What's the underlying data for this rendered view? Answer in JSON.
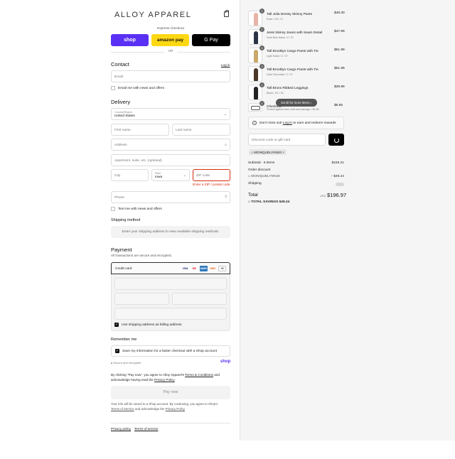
{
  "header": {
    "brand": "ALLOY APPAREL",
    "cart_icon": "shopping-bag-icon"
  },
  "express": {
    "title": "Express checkout",
    "buttons": [
      {
        "label": "shop",
        "color": "#5a31f4"
      },
      {
        "label": "amazon pay",
        "color": "#ffd814"
      },
      {
        "label": "G Pay",
        "color": "#000000"
      }
    ],
    "or": "OR"
  },
  "contact": {
    "title": "Contact",
    "login": "Log in",
    "email_placeholder": "Email",
    "email_news": "Email me with news and offers"
  },
  "delivery": {
    "title": "Delivery",
    "country_label": "Country/Region",
    "country_value": "United States",
    "first_name": "First name",
    "last_name": "Last name",
    "address": "Address",
    "apartment": "Apartment, suite, etc. (optional)",
    "city": "City",
    "state_label": "State",
    "state_value": "Iowa",
    "zip": "ZIP code",
    "zip_error": "Enter a ZIP / postal code",
    "phone": "Phone",
    "text_news": "Text me with news and offers"
  },
  "shipping_method": {
    "title": "Shipping method",
    "note": "Enter your shipping address to view available shipping methods."
  },
  "payment": {
    "title": "Payment",
    "subtitle": "All transactions are secure and encrypted.",
    "credit_card": "Credit card",
    "cards": [
      "VISA",
      "MC",
      "AMEX",
      "DISC",
      "+3"
    ],
    "billing_same": "Use shipping address as billing address"
  },
  "remember": {
    "title": "Remember me",
    "save_info": "Save my information for a faster checkout with a Shop account",
    "secure": "Secure and encrypted",
    "shop": "shop"
  },
  "legal": {
    "consent_1": "By clicking \"Pay now\", you agree to Alloy Apparel's ",
    "terms": "Terms & Conditions",
    "consent_2": " and",
    "consent_3": "acknowledge having read the ",
    "privacy": "Privacy Policy",
    "pay_now": "Pay now",
    "shop_note_1": "Your info will be saved to a Shop account. By continuing, you agree to Shop's",
    "shop_terms": "Terms of Service",
    "shop_note_2": " and acknowledge the ",
    "shop_privacy": "Privacy Policy",
    "footer_privacy": "Privacy policy",
    "footer_terms": "Terms of service"
  },
  "cart": {
    "items": [
      {
        "qty": "1",
        "name": "Tall Julia Dressy Skinny Pants",
        "variant": "Rose / XS / 37",
        "price": "$48.30",
        "color": "#e8b4a8"
      },
      {
        "qty": "1",
        "name": "Jessi Skinny Jeans with Seam Detail",
        "variant": "Dark Blue Wash / 2 / 37",
        "price": "$47.99",
        "color": "#2c3344"
      },
      {
        "qty": "1",
        "name": "Tall Brooklyn Cargo Pants with Tie",
        "variant": "Light Khaki / 2 / 37",
        "price": "$51.99",
        "color": "#c9a96a"
      },
      {
        "qty": "1",
        "name": "Tall Brooklyn Cargo Pants with Tie",
        "variant": "Dark Chocolate / 2 / 37",
        "price": "$51.99",
        "color": "#4a3728"
      },
      {
        "qty": "1",
        "name": "Tall Bronx Ribbed Leggings",
        "variant": "Black / XS / 35",
        "price": "$39.99",
        "color": "#222222"
      },
      {
        "qty": "1",
        "name": "Checkout+",
        "variant": "Protect against loss, theft and damage • $3.95",
        "price": "$5.95",
        "color": "#888888"
      }
    ],
    "scroll_hint": "Scroll for more items",
    "rewards_1": "Don't miss out! ",
    "rewards_login": "Log in",
    "rewards_2": " to earn and redeem rewards",
    "discount_placeholder": "Discount code or gift card",
    "tag": "MONIQUELYNN20",
    "subtotal_label": "Subtotal · 6 items",
    "subtotal_value": "$246.21",
    "order_discount": "Order discount",
    "discount_code": "MONIQUELYNN20",
    "discount_value": "− $49.24",
    "shipping_label": "Shipping",
    "total_label": "Total",
    "currency": "USD",
    "total_value": "$196.97",
    "savings_label": "TOTAL SAVINGS",
    "savings_value": "$49.24"
  }
}
